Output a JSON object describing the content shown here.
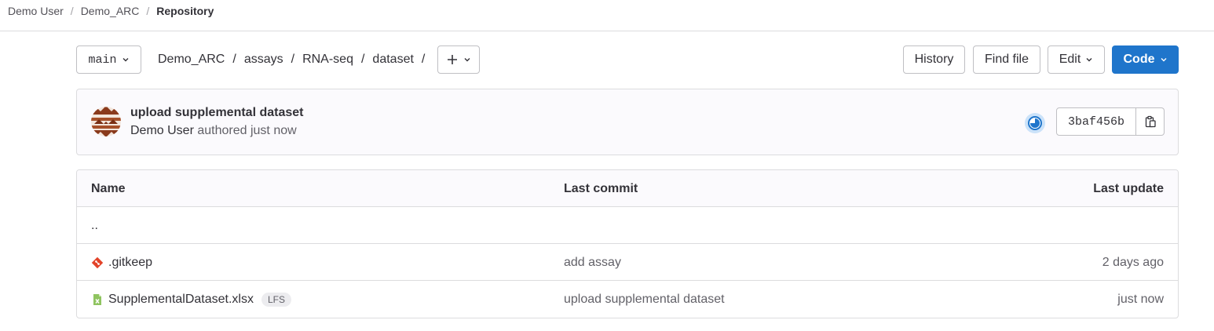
{
  "breadcrumb": {
    "items": [
      "Demo User",
      "Demo_ARC"
    ],
    "current": "Repository"
  },
  "toolbar": {
    "branch": "main",
    "path": [
      "Demo_ARC",
      "assays",
      "RNA-seq",
      "dataset"
    ],
    "path_separator": "/",
    "add_icon": "plus-icon",
    "history_label": "History",
    "find_file_label": "Find file",
    "edit_label": "Edit",
    "code_label": "Code",
    "accent_color": "#1f75cb"
  },
  "commit": {
    "title": "upload supplemental dataset",
    "author": "Demo User",
    "meta_suffix": "authored just now",
    "sha": "3baf456b",
    "pipeline_icon": "pipeline-running-icon",
    "copy_icon": "copy-to-clipboard-icon"
  },
  "file_table": {
    "columns": [
      "Name",
      "Last commit",
      "Last update"
    ],
    "parent_dir": "..",
    "rows": [
      {
        "name": ".gitkeep",
        "icon": "git-file-icon",
        "commit": "add assay",
        "updated": "2 days ago",
        "badge": ""
      },
      {
        "name": "SupplementalDataset.xlsx",
        "icon": "spreadsheet-file-icon",
        "commit": "upload supplemental dataset",
        "updated": "just now",
        "badge": "LFS"
      }
    ]
  }
}
